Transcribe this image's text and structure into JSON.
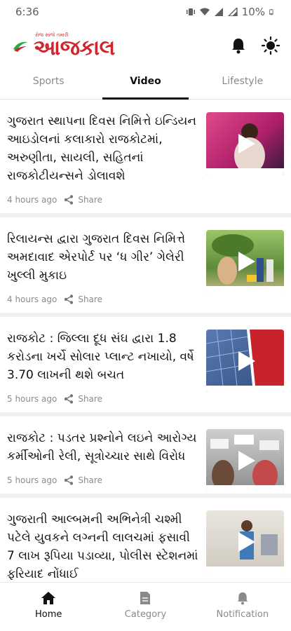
{
  "status_bar": {
    "time": "6:36",
    "battery": "10%"
  },
  "header": {
    "logo_tagline": "રોજ સાંજે તમારી",
    "logo_text": "આજકાલ"
  },
  "tabs": [
    {
      "label": "Sports",
      "active": false
    },
    {
      "label": "Video",
      "active": true
    },
    {
      "label": "Lifestyle",
      "active": false
    }
  ],
  "articles": [
    {
      "headline": "ગુજરાત સ્થાપના દિવસ નિમિત્તે ઇન્ડિયન આઇડોલનાં કલાકારો રાજકોટમાં, અરુણીતા, સાયલી, સહિતનાં રાજકોટીયન્સને ડોલાવશે",
      "time": "4 hours ago",
      "share": "Share"
    },
    {
      "headline": "રિલાયન્સ દ્વારા ગુજરાત દિવસ નિમિત્તે અમદાવાદ એરપોર્ટ પર ‘ધ ગીર’ ગેલેરી ખુલ્લી મુકાઇ",
      "time": "4 hours ago",
      "share": "Share"
    },
    {
      "headline": "રાજકોટ : જિલ્લા દૂધ સંઘ દ્વારા 1.8 કરોડના ખર્ચે સોલાર પ્લાન્ટ નખાયો, વર્ષે 3.70 લાખની થશે બચત",
      "time": "5 hours ago",
      "share": "Share"
    },
    {
      "headline": "રાજકોટ : પડતર પ્રશ્નોને લઇને આરોગ્ય કર્મીઓની રેલી, સૂત્રોચ્ચાર સાથે વિરોધ",
      "time": "5 hours ago",
      "share": "Share"
    },
    {
      "headline": "ગુજરાતી આલ્બમની અભિનેત્રી ચશ્મી પટેલે યુવકને લગ્નની લાલચમાં ફસાવી 7 લાખ રૂપિયા પડાવ્યા, પોલીસ સ્ટેશનમાં ફરિયાદ નોંધાઈ",
      "time": "",
      "share": ""
    }
  ],
  "bottom_nav": [
    {
      "label": "Home",
      "active": true
    },
    {
      "label": "Category",
      "active": false
    },
    {
      "label": "Notification",
      "active": false
    }
  ],
  "colors": {
    "brand": "#d0262b",
    "active_text": "#111111",
    "muted_text": "#8a8a8a"
  }
}
